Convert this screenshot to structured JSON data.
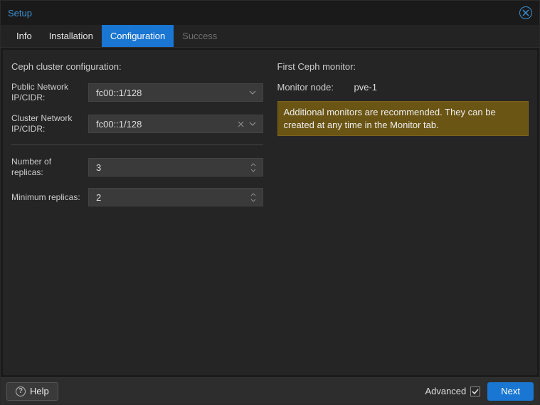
{
  "window": {
    "title": "Setup"
  },
  "tabs": {
    "info": "Info",
    "installation": "Installation",
    "configuration": "Configuration",
    "success": "Success"
  },
  "left": {
    "section_title": "Ceph cluster configuration:",
    "public_network_label": "Public Network IP/CIDR:",
    "public_network_value": "fc00::1/128",
    "cluster_network_label": "Cluster Network IP/CIDR:",
    "cluster_network_value": "fc00::1/128",
    "replicas_label": "Number of replicas:",
    "replicas_value": "3",
    "min_replicas_label": "Minimum replicas:",
    "min_replicas_value": "2"
  },
  "right": {
    "section_title": "First Ceph monitor:",
    "monitor_node_label": "Monitor node:",
    "monitor_node_value": "pve-1",
    "warning": "Additional monitors are recommended. They can be created at any time in the Monitor tab."
  },
  "footer": {
    "help": "Help",
    "advanced": "Advanced",
    "next": "Next"
  }
}
